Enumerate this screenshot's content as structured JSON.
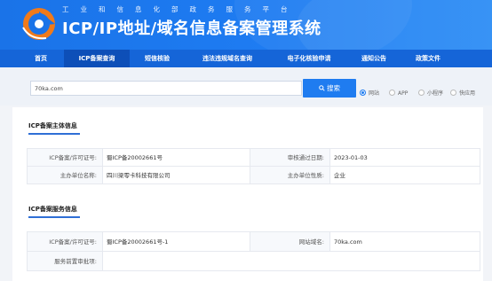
{
  "header": {
    "subtitle": "工业和信息化部政务服务平台",
    "title": "ICP/IP地址/域名信息备案管理系统"
  },
  "nav": {
    "items": [
      {
        "label": "首页",
        "active": false
      },
      {
        "label": "ICP备案查询",
        "active": true
      },
      {
        "label": "短信核验",
        "active": false
      },
      {
        "label": "违法违规域名查询",
        "active": false
      },
      {
        "label": "电子化核验申请",
        "active": false
      },
      {
        "label": "通知公告",
        "active": false
      },
      {
        "label": "政策文件",
        "active": false
      }
    ]
  },
  "search": {
    "value": "70ka.com",
    "button_label": "搜索",
    "types": [
      {
        "label": "网站",
        "checked": true
      },
      {
        "label": "APP",
        "checked": false
      },
      {
        "label": "小程序",
        "checked": false
      },
      {
        "label": "快应用",
        "checked": false
      }
    ]
  },
  "subject_section": {
    "title": "ICP备案主体信息",
    "rows": [
      [
        "ICP备案/许可证号:",
        "蜀ICP备20002661号",
        "审核通过日期:",
        "2023-01-03"
      ],
      [
        "主办单位名称:",
        "四川梁零卡科技有限公司",
        "主办单位性质:",
        "企业"
      ]
    ]
  },
  "service_section": {
    "title": "ICP备案服务信息",
    "rows": [
      [
        "ICP备案/许可证号:",
        "蜀ICP备20002661号-1",
        "网站域名:",
        "70ka.com"
      ],
      [
        "服务前置审批项:",
        ""
      ]
    ]
  },
  "colors": {
    "header_blue": "#1a73e8",
    "nav_blue": "#1565d8",
    "nav_active": "#0d4fb8",
    "button_blue": "#1f7cf0",
    "logo_orange": "#f07a1a"
  }
}
